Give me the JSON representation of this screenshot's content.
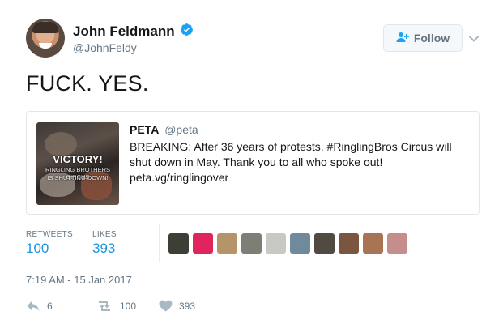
{
  "author": {
    "display_name": "John Feldmann",
    "handle": "@JohnFeldy",
    "verified": true
  },
  "follow_label": "Follow",
  "tweet_text": "FUCK. YES.",
  "quote": {
    "author_name": "PETA",
    "author_handle": "@peta",
    "text_lines": [
      "BREAKING: After 36 years of protests, #RinglingBros Circus will",
      "shut down in May. Thank you to all who spoke out!",
      "peta.vg/ringlingover"
    ],
    "media_text": {
      "line1": "VICTORY!",
      "line2": "RINGLING BROTHERS CIRCUS",
      "line3": "IS SHUTTING DOWN!"
    }
  },
  "stats": {
    "retweets_label": "RETWEETS",
    "retweets_value": "100",
    "likes_label": "LIKES",
    "likes_value": "393"
  },
  "liker_avatar_colors": [
    "#3b3f36",
    "#e0245e",
    "#b59468",
    "#7d7f75",
    "#c9c9c3",
    "#6f8a9a",
    "#514a43",
    "#7a5640",
    "#a77454",
    "#c48f8a"
  ],
  "timestamp": "7:19 AM - 15 Jan 2017",
  "actions": {
    "reply_count": "6",
    "retweet_count": "100",
    "like_count": "393"
  },
  "colors": {
    "link": "#1b95e0",
    "verified": "#1da1f2",
    "muted": "#657786"
  }
}
